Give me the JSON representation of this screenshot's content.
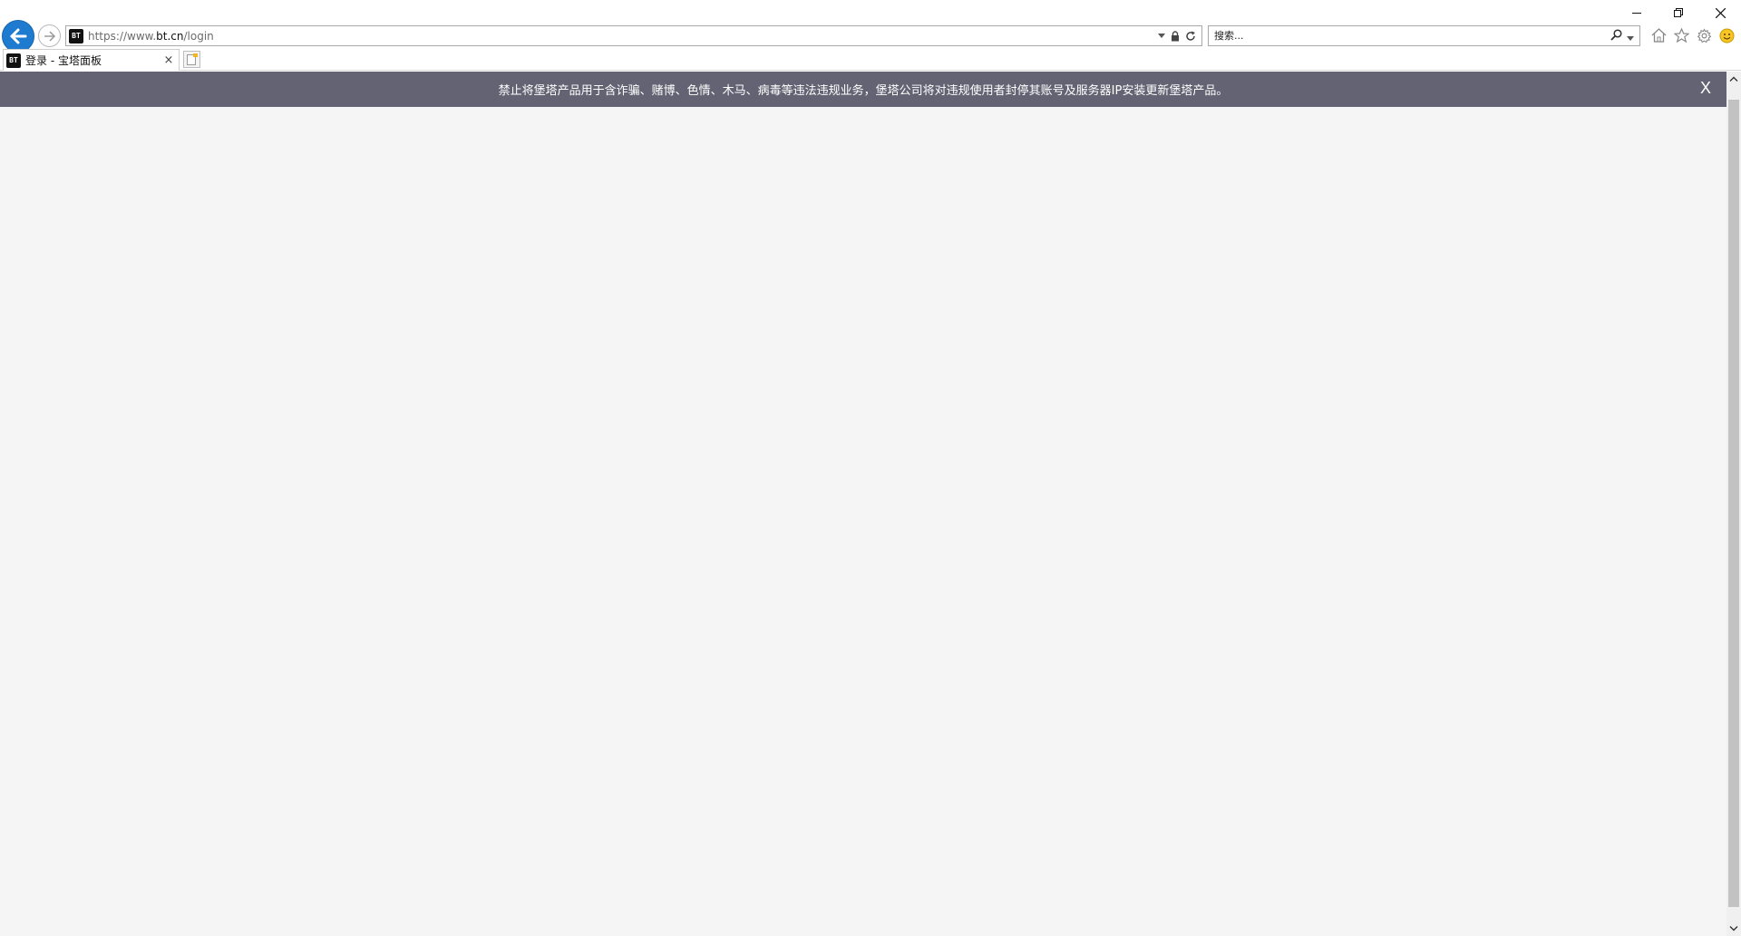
{
  "browser": {
    "address": {
      "scheme_part": "https://www.",
      "domain_part": "bt.cn",
      "path_part": "/login",
      "lock_icon": "lock-icon",
      "refresh_icon": "refresh-icon"
    },
    "search": {
      "placeholder": "搜索..."
    },
    "favicon_text": "BT",
    "tab": {
      "title": "登录 - 宝塔面板",
      "close": "×"
    },
    "toolbar_icons": [
      "home-icon",
      "favorites-star-icon",
      "settings-gear-icon",
      "feedback-smiley-icon"
    ],
    "window_controls": [
      "minimize-icon",
      "restore-icon",
      "close-icon"
    ]
  },
  "page": {
    "notice": {
      "text": "禁止将堡塔产品用于含诈骗、赌博、色情、木马、病毒等违法违规业务，堡塔公司将对违规使用者封停其账号及服务器IP安装更新堡塔产品。",
      "close": "X"
    },
    "background_color": "#f5f5f5",
    "notice_color": "#636373"
  },
  "colors": {
    "back_button": "#1e7bd0"
  }
}
